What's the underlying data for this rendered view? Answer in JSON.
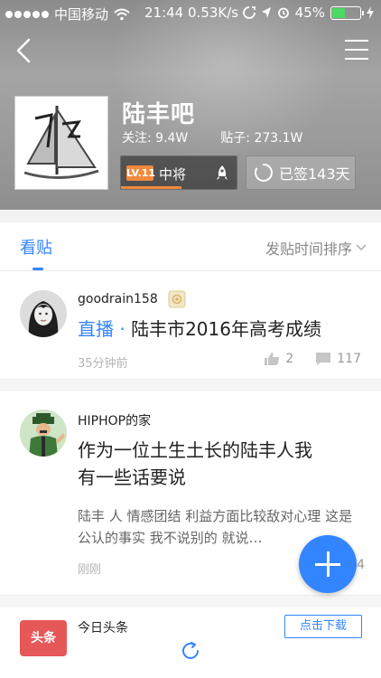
{
  "status_bar": {
    "carrier": "中国移动",
    "time": "21:44",
    "speed": "0.53K/s",
    "battery": "45%",
    "battery_level": 0.45
  },
  "forum": {
    "name": "陆丰吧",
    "follow_label": "关注:",
    "follow_count": "9.4W",
    "posts_label": "贴子:",
    "posts_count": "273.1W",
    "level_badge": "LV.11",
    "level_title": "中将",
    "level_progress": 0.52,
    "signed_text": "已签143天"
  },
  "tabs": {
    "posts": "看贴",
    "sort": "发贴时间排序"
  },
  "posts": [
    {
      "username": "goodrain158",
      "tag": "直播",
      "title": "陆丰市2016年高考成绩",
      "time": "35分钟前",
      "likes": "2",
      "comments": "117"
    },
    {
      "username": "HIPHOP的家",
      "title_line1": "作为一位土生土长的陆丰人我",
      "title_line2": "有一些话要说",
      "body": "陆丰 人 情感团结 利益方面比较敌对心理 这是公认的事实 我不说别的 就说…",
      "time": "刚刚",
      "comments_partial": "4"
    }
  ],
  "ad": {
    "name": "今日头条",
    "logo_text": "头条",
    "download": "点击下载"
  },
  "colors": {
    "accent": "#3385ff",
    "level_orange": "#f08a3e",
    "battery_green": "#4cd964"
  }
}
